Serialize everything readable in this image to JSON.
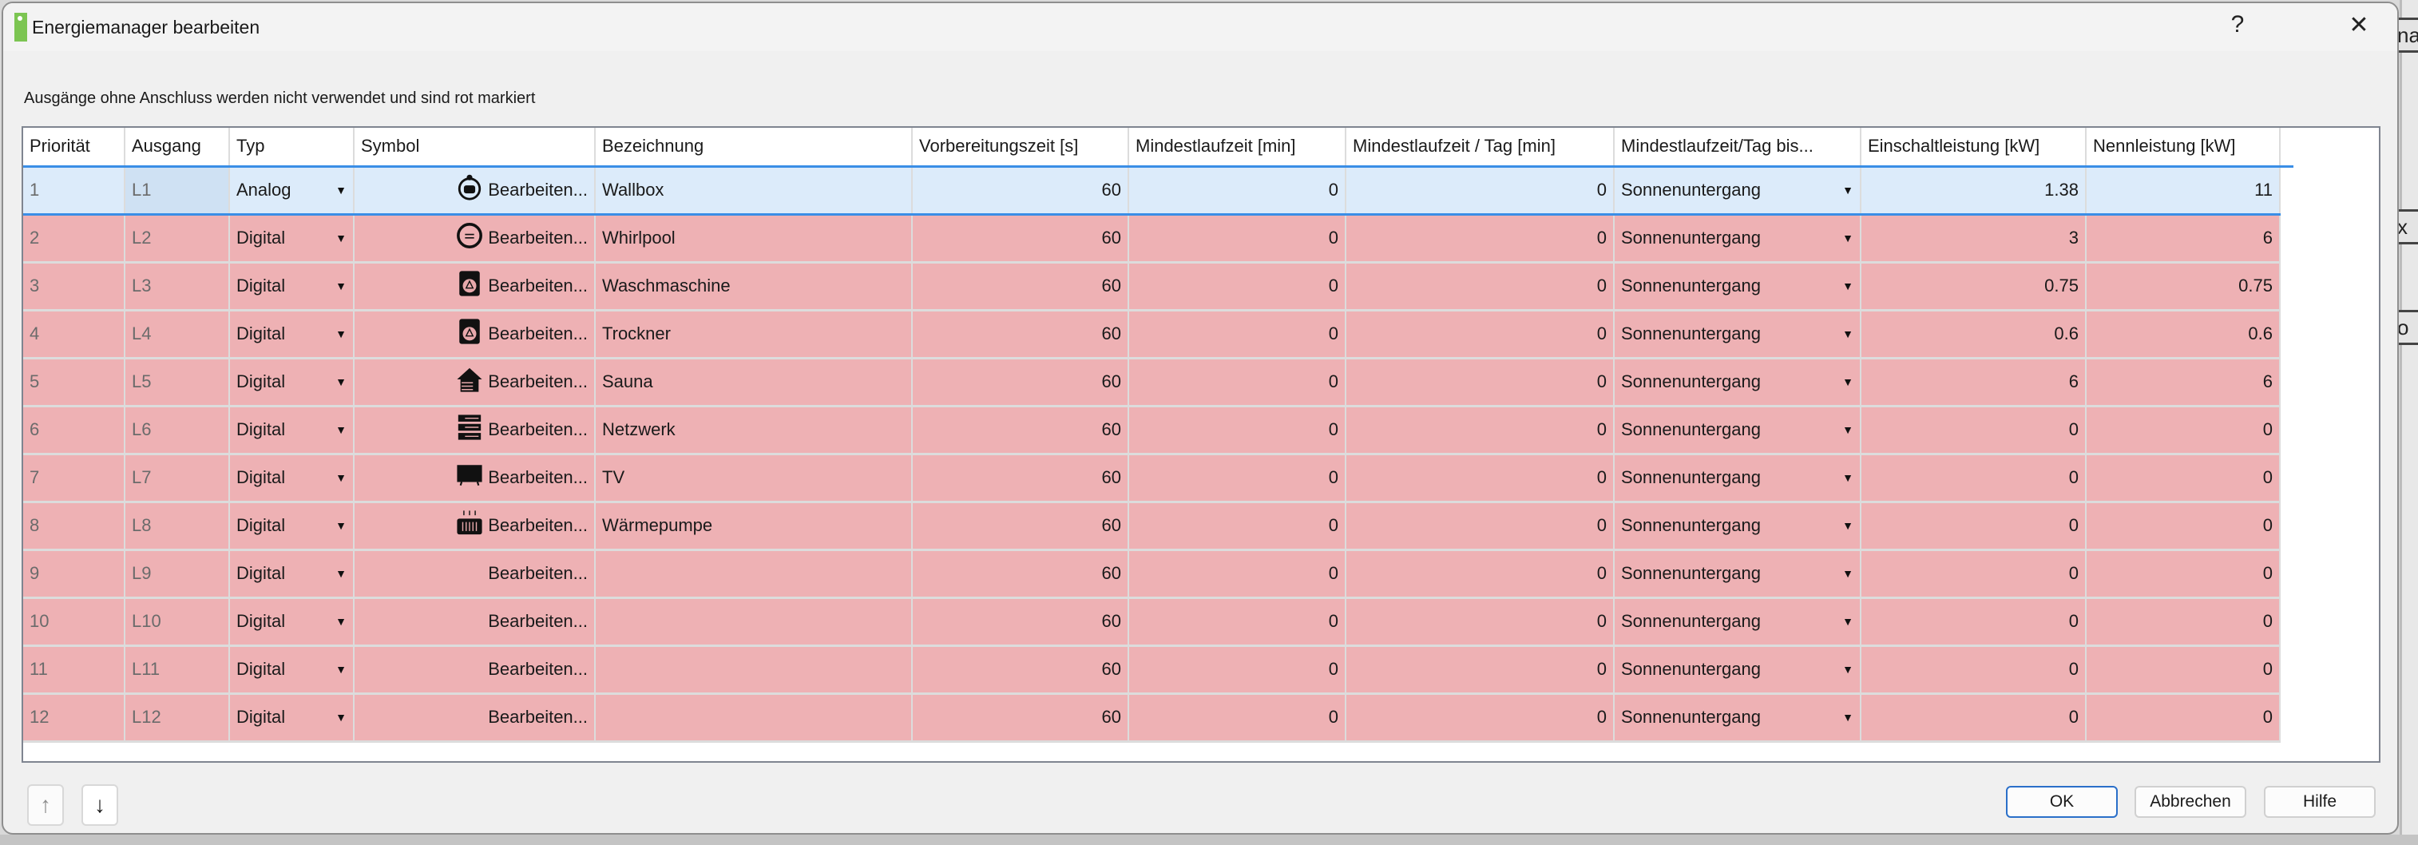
{
  "window": {
    "title": "Energiemanager bearbeiten",
    "help": "?",
    "close": "✕"
  },
  "info_text": "Ausgänge ohne Anschluss werden nicht verwendet und sind rot markiert",
  "background_fragments": [
    "na",
    "x",
    "o"
  ],
  "columns": [
    "Priorität",
    "Ausgang",
    "Typ",
    "Symbol",
    "Bezeichnung",
    "Vorbereitungszeit [s]",
    "Mindestlaufzeit [min]",
    "Mindestlaufzeit / Tag [min]",
    "Mindestlaufzeit/Tag bis...",
    "Einschaltleistung [kW]",
    "Nennleistung [kW]"
  ],
  "edit_label": "Bearbeiten...",
  "colors": {
    "unconnected_row": "#eeb1b4",
    "selected_row": "#dcebfa",
    "accent": "#3a8ee6"
  },
  "rows": [
    {
      "prio": "1",
      "out": "L1",
      "type": "Analog",
      "icon": "wallbox-icon",
      "name": "Wallbox",
      "prep": "60",
      "min": "0",
      "minday": "0",
      "until": "Sonnenuntergang",
      "on": "1.38",
      "nom": "11",
      "selected": true
    },
    {
      "prio": "2",
      "out": "L2",
      "type": "Digital",
      "icon": "whirlpool-icon",
      "name": "Whirlpool",
      "prep": "60",
      "min": "0",
      "minday": "0",
      "until": "Sonnenuntergang",
      "on": "3",
      "nom": "6"
    },
    {
      "prio": "3",
      "out": "L3",
      "type": "Digital",
      "icon": "washing-machine-icon",
      "name": "Waschmaschine",
      "prep": "60",
      "min": "0",
      "minday": "0",
      "until": "Sonnenuntergang",
      "on": "0.75",
      "nom": "0.75"
    },
    {
      "prio": "4",
      "out": "L4",
      "type": "Digital",
      "icon": "dryer-icon",
      "name": "Trockner",
      "prep": "60",
      "min": "0",
      "minday": "0",
      "until": "Sonnenuntergang",
      "on": "0.6",
      "nom": "0.6"
    },
    {
      "prio": "5",
      "out": "L5",
      "type": "Digital",
      "icon": "sauna-icon",
      "name": "Sauna",
      "prep": "60",
      "min": "0",
      "minday": "0",
      "until": "Sonnenuntergang",
      "on": "6",
      "nom": "6"
    },
    {
      "prio": "6",
      "out": "L6",
      "type": "Digital",
      "icon": "network-icon",
      "name": "Netzwerk",
      "prep": "60",
      "min": "0",
      "minday": "0",
      "until": "Sonnenuntergang",
      "on": "0",
      "nom": "0"
    },
    {
      "prio": "7",
      "out": "L7",
      "type": "Digital",
      "icon": "tv-icon",
      "name": "TV",
      "prep": "60",
      "min": "0",
      "minday": "0",
      "until": "Sonnenuntergang",
      "on": "0",
      "nom": "0"
    },
    {
      "prio": "8",
      "out": "L8",
      "type": "Digital",
      "icon": "heat-pump-icon",
      "name": "Wärmepumpe",
      "prep": "60",
      "min": "0",
      "minday": "0",
      "until": "Sonnenuntergang",
      "on": "0",
      "nom": "0"
    },
    {
      "prio": "9",
      "out": "L9",
      "type": "Digital",
      "icon": "",
      "name": "",
      "prep": "60",
      "min": "0",
      "minday": "0",
      "until": "Sonnenuntergang",
      "on": "0",
      "nom": "0"
    },
    {
      "prio": "10",
      "out": "L10",
      "type": "Digital",
      "icon": "",
      "name": "",
      "prep": "60",
      "min": "0",
      "minday": "0",
      "until": "Sonnenuntergang",
      "on": "0",
      "nom": "0"
    },
    {
      "prio": "11",
      "out": "L11",
      "type": "Digital",
      "icon": "",
      "name": "",
      "prep": "60",
      "min": "0",
      "minday": "0",
      "until": "Sonnenuntergang",
      "on": "0",
      "nom": "0"
    },
    {
      "prio": "12",
      "out": "L12",
      "type": "Digital",
      "icon": "",
      "name": "",
      "prep": "60",
      "min": "0",
      "minday": "0",
      "until": "Sonnenuntergang",
      "on": "0",
      "nom": "0"
    }
  ],
  "buttons": {
    "up": "↑",
    "down": "↓",
    "ok": "OK",
    "cancel": "Abbrechen",
    "help": "Hilfe"
  }
}
